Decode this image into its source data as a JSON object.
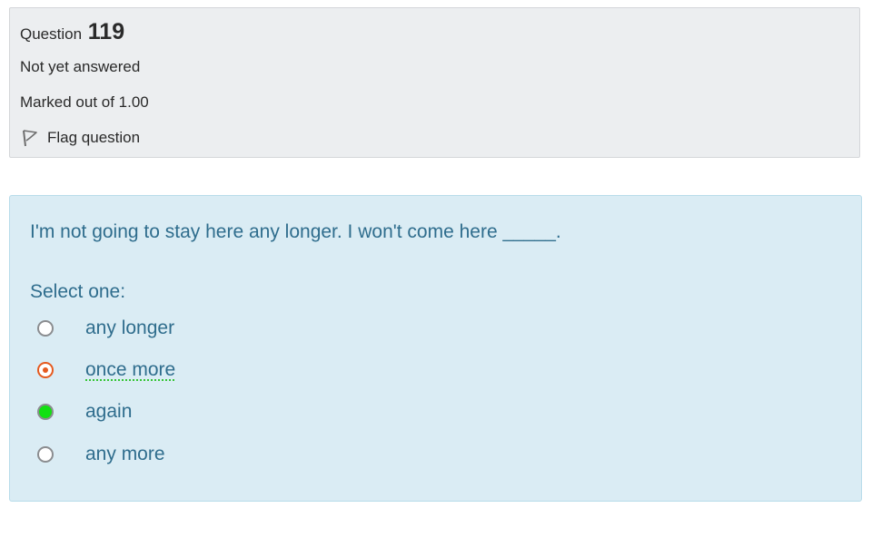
{
  "info": {
    "question_label": "Question",
    "question_number": "119",
    "state": "Not yet answered",
    "grade": "Marked out of 1.00",
    "flag_label": "Flag question",
    "flag_icon": "flag-icon"
  },
  "question": {
    "text": "I'm not going to stay here any longer. I won't come here _____.",
    "prompt": "Select one:",
    "options": [
      {
        "label": "any longer",
        "selected": false
      },
      {
        "label": "once more",
        "selected": true
      },
      {
        "label": "again",
        "selected": false
      },
      {
        "label": "any more",
        "selected": false
      }
    ]
  },
  "colors": {
    "info_background": "#eceef0",
    "question_background": "#daecf4",
    "question_text": "#2f6d8d",
    "selected_radio": "#e55a1f",
    "highlight_radio": "#12e012"
  }
}
